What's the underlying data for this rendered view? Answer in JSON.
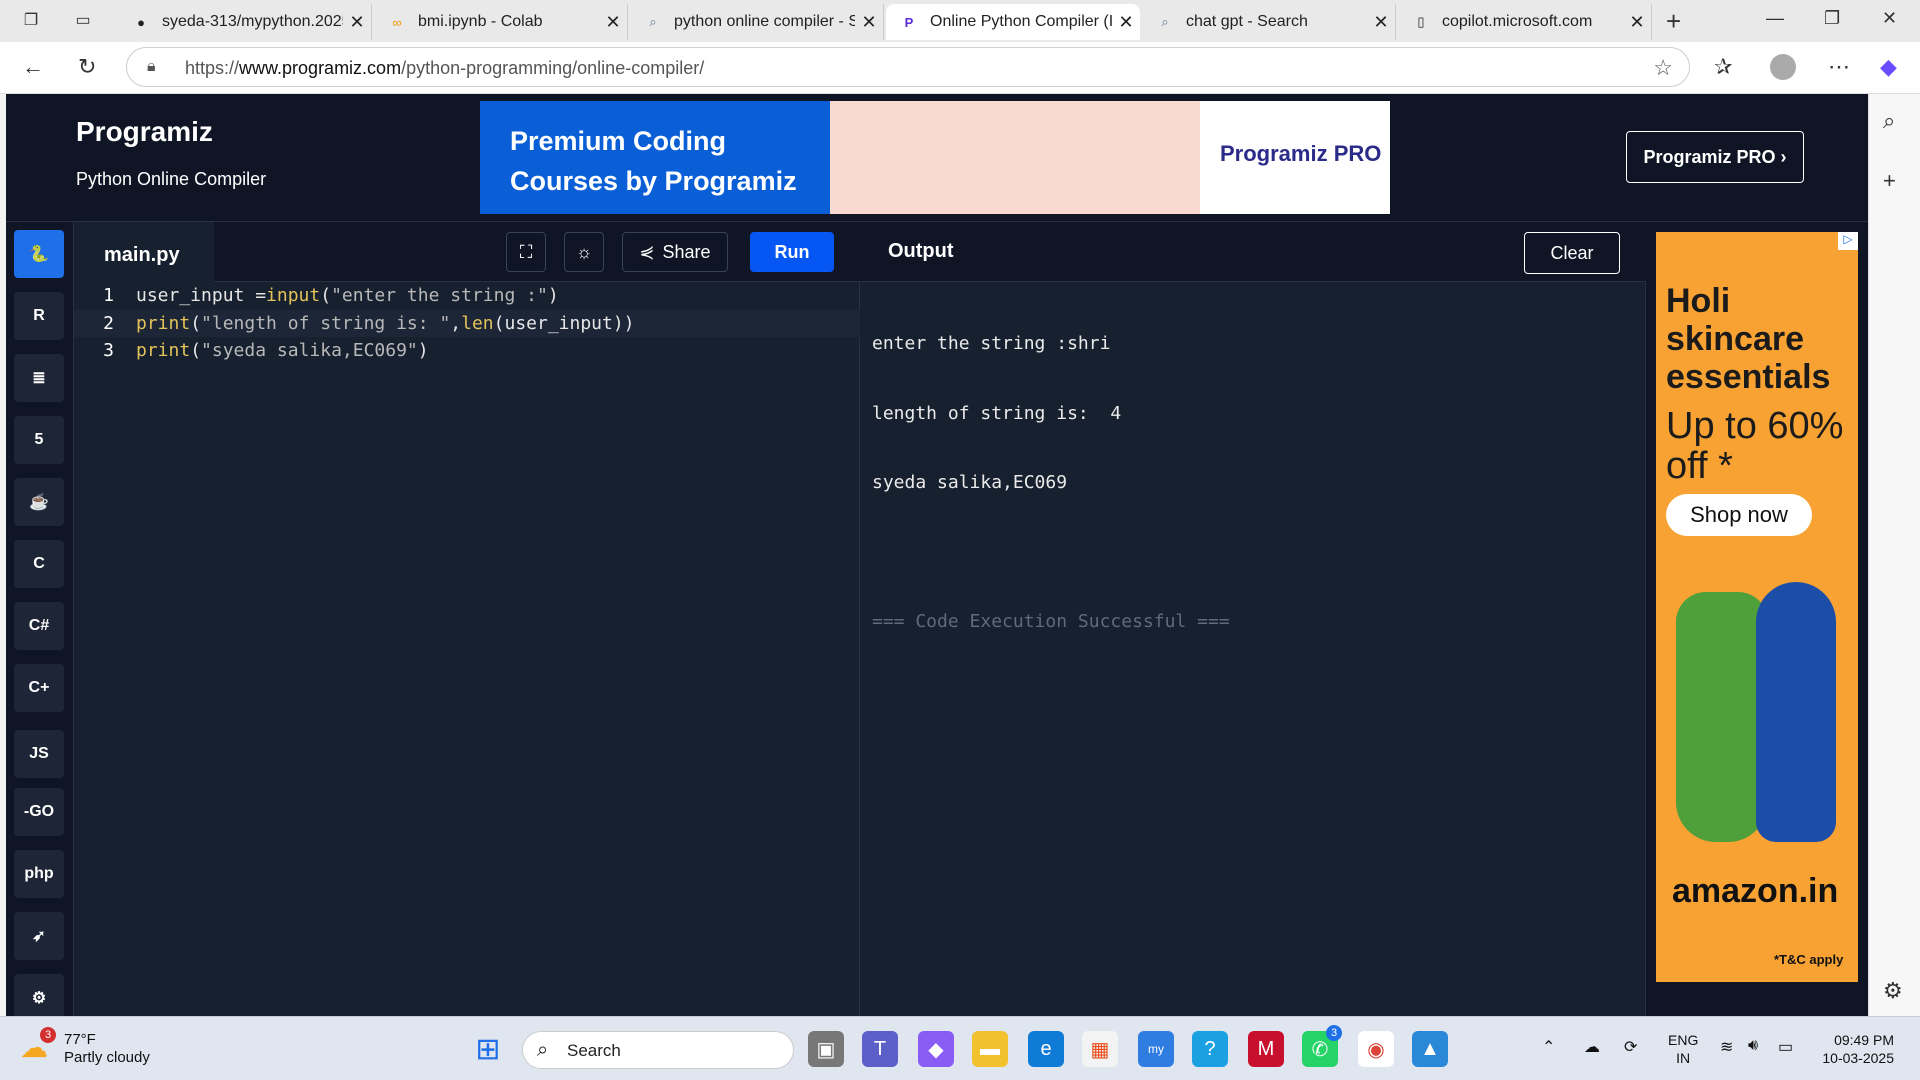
{
  "browser": {
    "tabs": [
      {
        "title": "syeda-313/mypython.2025",
        "icon": "github-icon"
      },
      {
        "title": "bmi.ipynb - Colab",
        "icon": "colab-icon"
      },
      {
        "title": "python online compiler - S",
        "icon": "search-icon"
      },
      {
        "title": "Online Python Compiler (In",
        "icon": "programiz-icon"
      },
      {
        "title": "chat gpt - Search",
        "icon": "search-icon"
      },
      {
        "title": "copilot.microsoft.com",
        "icon": "page-icon"
      }
    ],
    "url_prefix": "https://",
    "url_domain": "www.programiz.com",
    "url_path": "/python-programming/online-compiler/"
  },
  "site": {
    "logo": "Programiz",
    "subtitle": "Python Online Compiler",
    "banner_text": "Premium Coding Courses by Programiz",
    "banner_brand": "Programiz PRO",
    "pro_button": "Programiz PRO ›"
  },
  "sidebar": {
    "langs": [
      {
        "name": "python",
        "label": "🐍"
      },
      {
        "name": "r",
        "label": "R"
      },
      {
        "name": "sql",
        "label": "≣"
      },
      {
        "name": "html",
        "label": "5"
      },
      {
        "name": "java",
        "label": "☕"
      },
      {
        "name": "c",
        "label": "C"
      },
      {
        "name": "csharp",
        "label": "C#"
      },
      {
        "name": "cpp",
        "label": "C+"
      },
      {
        "name": "js",
        "label": "JS"
      },
      {
        "name": "go",
        "label": "-GO"
      },
      {
        "name": "php",
        "label": "php"
      },
      {
        "name": "swift",
        "label": "➶"
      },
      {
        "name": "rust",
        "label": "⚙"
      }
    ]
  },
  "editor": {
    "file_tab": "main.py",
    "share_label": "Share",
    "run_label": "Run",
    "lines": [
      {
        "no": "1"
      },
      {
        "no": "2"
      },
      {
        "no": "3"
      }
    ]
  },
  "output": {
    "title": "Output",
    "clear_label": "Clear",
    "lines": [
      "enter the string :shri",
      "length of string is:  4",
      "syeda salika,EC069"
    ],
    "status": "=== Code Execution Successful ==="
  },
  "ad": {
    "headline": "Holi skincare essentials",
    "offer": "Up to 60% off *",
    "cta": "Shop now",
    "brand": "amazon.in",
    "terms": "*T&C apply"
  },
  "taskbar": {
    "temp": "77°F",
    "weather": "Partly cloudy",
    "weather_badge": "3",
    "search_label": "Search",
    "lang_line1": "ENG",
    "lang_line2": "IN",
    "time": "09:49 PM",
    "date": "10-03-2025",
    "whatsapp_badge": "3"
  }
}
